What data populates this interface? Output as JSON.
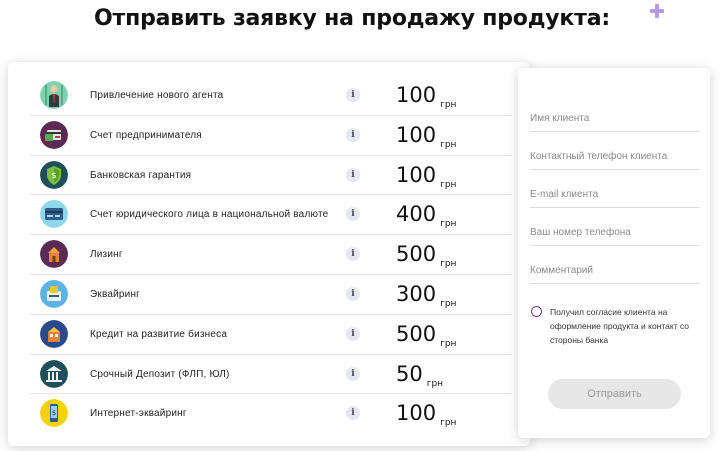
{
  "page": {
    "title": "Отправить заявку на продажу продукта:"
  },
  "products": [
    {
      "name": "Привлечение нового агента",
      "price": "100",
      "currency": "грн",
      "icon": "agent-person-icon"
    },
    {
      "name": "Счет предпринимателя",
      "price": "100",
      "currency": "грн",
      "icon": "entrepreneur-account-icon"
    },
    {
      "name": "Банковская гарантия",
      "price": "100",
      "currency": "грн",
      "icon": "bank-guarantee-shield-icon"
    },
    {
      "name": "Счет юридического лица в национальной валюте",
      "price": "400",
      "currency": "грн",
      "icon": "credit-card-icon"
    },
    {
      "name": "Лизинг",
      "price": "500",
      "currency": "грн",
      "icon": "leasing-building-icon"
    },
    {
      "name": "Эквайринг",
      "price": "300",
      "currency": "грн",
      "icon": "pos-terminal-icon"
    },
    {
      "name": "Кредит на развитие бизнеса",
      "price": "500",
      "currency": "грн",
      "icon": "business-credit-icon"
    },
    {
      "name": "Срочный Депозит (ФЛП, ЮЛ)",
      "price": "50",
      "currency": "грн",
      "icon": "bank-columns-icon"
    },
    {
      "name": "Интернет-эквайринг",
      "price": "100",
      "currency": "грн",
      "icon": "mobile-payment-icon"
    }
  ],
  "info_glyph": "i",
  "form": {
    "client_name_placeholder": "Имя клиента",
    "client_phone_placeholder": "Контактный телефон клиента",
    "client_email_placeholder": "E-mail клиента",
    "your_phone_placeholder": "Ваш номер телефона",
    "comment_placeholder": "Комментарий",
    "consent_text": "Получил согласие клиента на оформление продукта и контакт со стороны банка",
    "consent_checked": false,
    "submit_label": "Отправить"
  },
  "colors": {
    "accent": "#6c3d9c",
    "plus_deco": "#b59be0",
    "button_bg": "#e7e7e7",
    "button_text": "#9a9a9a"
  }
}
